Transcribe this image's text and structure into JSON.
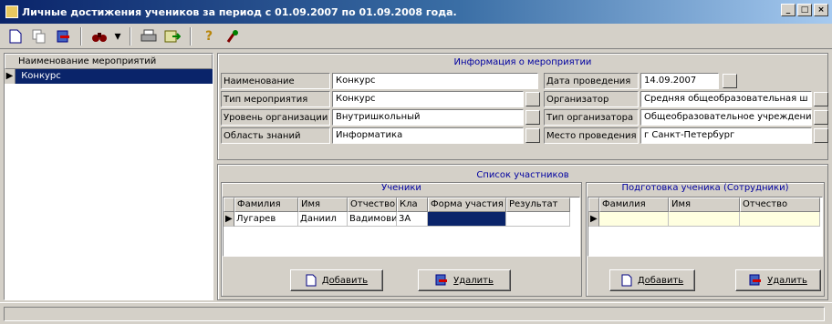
{
  "window": {
    "title": "Личные достижения учеников за период с 01.09.2007 по 01.09.2008 года.",
    "controls": [
      "_",
      "□",
      "×"
    ]
  },
  "toolbar": {
    "icons": [
      "new-icon",
      "copy-icon",
      "delete-icon",
      "binoculars-icon",
      "print-icon",
      "export-icon",
      "help-icon",
      "settings-icon"
    ],
    "dropdown_arrow": "▾",
    "help_glyph": "?"
  },
  "events_list": {
    "header": "Наименование мероприятий",
    "rows": [
      {
        "indicator": "▶",
        "name": "Конкурс"
      }
    ]
  },
  "event_info": {
    "title": "Информация о мероприятии",
    "fields": {
      "name": {
        "label": "Наименование",
        "value": "Конкурс"
      },
      "type": {
        "label": "Тип мероприятия",
        "value": "Конкурс"
      },
      "level": {
        "label": "Уровень организации",
        "value": "Внутришкольный"
      },
      "area": {
        "label": "Область знаний",
        "value": "Информатика"
      },
      "date": {
        "label": "Дата проведения",
        "value": "14.09.2007"
      },
      "organizer": {
        "label": "Организатор",
        "value": "Средняя общеобразовательная ш"
      },
      "organizer_type": {
        "label": "Тип организатора",
        "value": "Общеобразовательное учреждени"
      },
      "place": {
        "label": "Место проведения",
        "value": "г Санкт-Петербург"
      }
    }
  },
  "participants": {
    "title": "Список участников",
    "students": {
      "title": "Ученики",
      "columns": [
        "Фамилия",
        "Имя",
        "Отчество",
        "Кла",
        "Форма участия",
        "Результат"
      ],
      "rows": [
        {
          "indicator": "▶",
          "cells": [
            "Лугарев",
            "Даниил",
            "Вадимович",
            "3А",
            "",
            ""
          ]
        }
      ]
    },
    "staff": {
      "title": "Подготовка ученика (Сотрудники)",
      "columns": [
        "Фамилия",
        "Имя",
        "Отчество"
      ],
      "rows": [
        {
          "indicator": "▶",
          "cells": [
            "",
            "",
            ""
          ]
        }
      ]
    },
    "add_label": "Добавить",
    "remove_label": "Удалить"
  },
  "colors": {
    "title_bar": "#0a246a",
    "selection": "#0a246a",
    "section_title": "#0000a0",
    "edit_row": "#ffffe0",
    "window": "#d4d0c8"
  }
}
